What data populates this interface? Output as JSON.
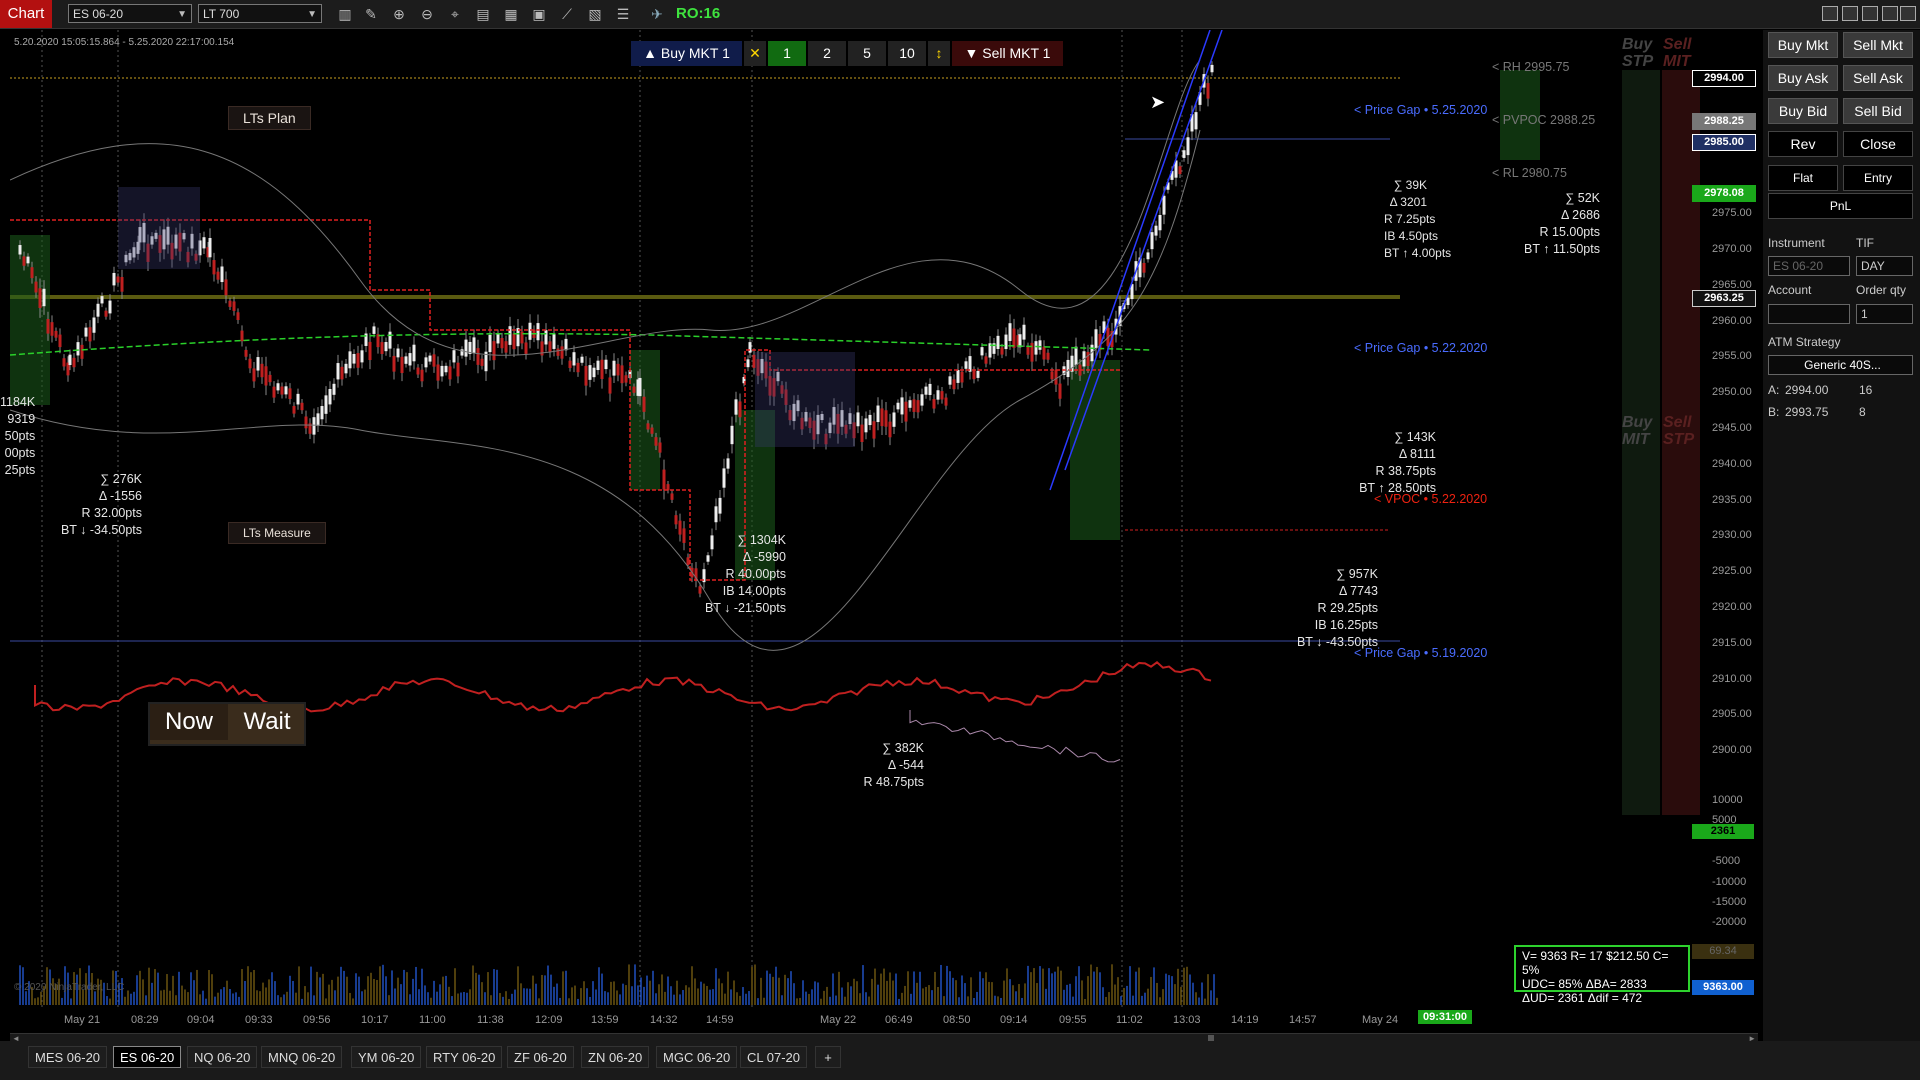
{
  "toolbar": {
    "chart_tab": "Chart",
    "instrument": "ES 06-20",
    "bar_type": "LT 700",
    "ro_label": "RO:16"
  },
  "chart": {
    "timestamp": "5.20.2020 15:05:15.864 - 5.25.2020 22:17:00.154",
    "lts_plan": "LTs Plan",
    "lts_measure": "LTs Measure",
    "now_label": "Now",
    "wait_label": "Wait",
    "order_bar": {
      "buy_label": "▲ Buy MKT 1",
      "close_x": "✕",
      "qty_options": [
        "1",
        "2",
        "5",
        "10"
      ],
      "sell_label": "▼ Sell MKT 1"
    },
    "stats": [
      {
        "id": "s0",
        "text": "1184K\n9319\n50pts\n00pts\n25pts"
      },
      {
        "id": "s1",
        "text": "∑ 276K\nΔ -1556\nR 32.00pts\nBT ↓ -34.50pts"
      },
      {
        "id": "s2",
        "text": "∑ 1304K\nΔ -5990\nR 40.00pts\nIB 14.00pts\nBT ↓ -21.50pts"
      },
      {
        "id": "s3",
        "text": "∑ 382K\nΔ -544\nR 48.75pts"
      },
      {
        "id": "s4",
        "text": "∑ 957K\nΔ 7743\nR 29.25pts\nIB 16.25pts\nBT ↓ -43.50pts"
      },
      {
        "id": "s5",
        "text": "∑ 143K\nΔ 8111\nR 38.75pts\nBT ↑ 28.50pts"
      },
      {
        "id": "s6",
        "text": "∑ 39K\nΔ 3201\nR 7.25pts\nIB 4.50pts\nBT ↑ 4.00pts"
      },
      {
        "id": "s7",
        "text": "∑ 52K\nΔ 2686\nR 15.00pts\nBT ↑ 11.50pts"
      }
    ],
    "gap_labels": [
      "< Price Gap • 5.25.2020",
      "< Price Gap • 5.22.2020",
      "< Price Gap • 5.19.2020"
    ],
    "vpoc_label": "< VPOC • 5.22.2020",
    "rh_label": "< RH 2995.75",
    "pvpoc_label": "< PVPOC 2988.25",
    "rl_label": "< RL 2980.75",
    "buy_stp": "Buy\nSTP",
    "sell_mit": "Sell\nMIT",
    "buy_mit": "Buy\nMIT",
    "sell_stp": "Sell\nSTP",
    "copyright": "© 2020 NinjaTrader, LLC",
    "info_box": [
      "V= 9363 R= 17 $212.50 C= 5%",
      "UDC= 85% ΔBA= 2833",
      "ΔUD= 2361 Δdif = 472"
    ]
  },
  "price_axis": {
    "ticks": [
      "2975.00",
      "2970.00",
      "2965.00",
      "2960.00",
      "2955.00",
      "2950.00",
      "2945.00",
      "2940.00",
      "2935.00",
      "2930.00",
      "2925.00",
      "2920.00",
      "2915.00",
      "2910.00",
      "2905.00",
      "2900.00"
    ],
    "tags": [
      {
        "text": "2994.00",
        "bg": "#000000",
        "fg": "#ffffff",
        "border": "#ffffff"
      },
      {
        "text": "2988.25",
        "bg": "#777777",
        "fg": "#ffffff",
        "border": "#777777"
      },
      {
        "text": "2985.00",
        "bg": "#1f2f63",
        "fg": "#ffffff",
        "border": "#ffffff"
      },
      {
        "text": "2978.08",
        "bg": "#1aa81a",
        "fg": "#ffffff",
        "border": "#1aa81a"
      },
      {
        "text": "2963.25",
        "bg": "#111111",
        "fg": "#ffffff",
        "border": "#cccccc"
      }
    ],
    "osc_ticks": [
      "10000",
      "5000",
      "-5000",
      "-10000",
      "-15000",
      "-20000"
    ],
    "osc_tag": "2361",
    "vol_tag_top": "69.34",
    "vol_tag": "9363.00"
  },
  "time_axis": {
    "labels": [
      "May 21",
      "08:29",
      "09:04",
      "09:33",
      "09:56",
      "10:17",
      "11:00",
      "11:38",
      "12:09",
      "13:59",
      "14:32",
      "14:59",
      "May 22",
      "06:49",
      "08:50",
      "09:14",
      "09:55",
      "11:02",
      "13:03",
      "14:19",
      "14:57",
      "May 24"
    ],
    "current": "09:31:00"
  },
  "panel": {
    "buy_mkt": "Buy Mkt",
    "sell_mkt": "Sell Mkt",
    "buy_ask": "Buy Ask",
    "sell_ask": "Sell Ask",
    "buy_bid": "Buy Bid",
    "sell_bid": "Sell Bid",
    "rev": "Rev",
    "close": "Close",
    "flat": "Flat",
    "entry": "Entry",
    "pnl": "PnL",
    "instrument_label": "Instrument",
    "instrument_value": "ES 06-20",
    "tif_label": "TIF",
    "tif_value": "DAY",
    "account_label": "Account",
    "account_value": "",
    "order_qty_label": "Order qty",
    "order_qty_value": "1",
    "atm_label": "ATM Strategy",
    "atm_value": "Generic 40S...",
    "ask_label": "A:",
    "ask_price": "2994.00",
    "ask_size": "16",
    "bid_label": "B:",
    "bid_price": "2993.75",
    "bid_size": "8"
  },
  "instrument_tabs": [
    "MES 06-20",
    "ES 06-20",
    "NQ 06-20",
    "MNQ 06-20",
    "YM 06-20",
    "RTY 06-20",
    "ZF 06-20",
    "ZN 06-20",
    "MGC 06-20",
    "CL 07-20"
  ],
  "active_tab": "ES 06-20",
  "add_tab": "+"
}
